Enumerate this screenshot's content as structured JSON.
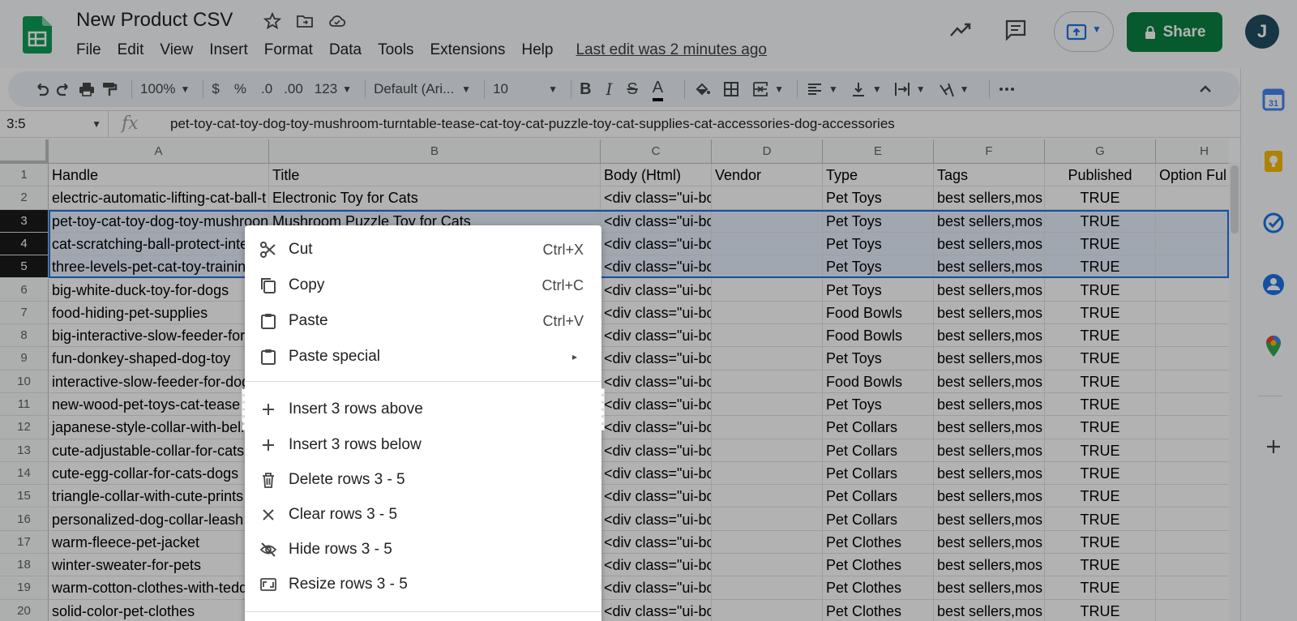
{
  "doc": {
    "title": "New Product CSV",
    "last_edit": "Last edit was 2 minutes ago"
  },
  "menus": [
    "File",
    "Edit",
    "View",
    "Insert",
    "Format",
    "Data",
    "Tools",
    "Extensions",
    "Help"
  ],
  "header": {
    "share_label": "Share",
    "avatar_initial": "J"
  },
  "toolbar": {
    "zoom": "100%",
    "currency": "$",
    "percent": "%",
    "dec_decrease": ".0",
    "dec_increase": ".00",
    "more_formats": "123",
    "font": "Default (Ari...",
    "font_size": "10",
    "bold": "B",
    "italic": "I",
    "strike": "S",
    "text_color": "A"
  },
  "formula": {
    "cell_ref": "3:5",
    "fx": "fx",
    "content": "pet-toy-cat-toy-dog-toy-mushroom-turntable-tease-cat-toy-cat-puzzle-toy-cat-supplies-cat-accessories-dog-accessories"
  },
  "grid": {
    "columns": [
      "A",
      "B",
      "C",
      "D",
      "E",
      "F",
      "G",
      "H"
    ],
    "rows": [
      {
        "n": "1",
        "cells": [
          "Handle",
          "Title",
          "Body (Html)",
          "Vendor",
          "Type",
          "Tags",
          "Published",
          "Option Ful"
        ]
      },
      {
        "n": "2",
        "cells": [
          "electric-automatic-lifting-cat-ball-t",
          "Electronic Toy for Cats",
          "<div class=\"ui-bo",
          "",
          "Pet Toys",
          "best sellers,mos",
          "TRUE",
          ""
        ]
      },
      {
        "n": "3",
        "cells": [
          "pet-toy-cat-toy-dog-toy-mushroon",
          "Mushroom Puzzle Toy for Cats",
          "<div class=\"ui-bo",
          "",
          "Pet Toys",
          "best sellers,mos",
          "TRUE",
          ""
        ]
      },
      {
        "n": "4",
        "cells": [
          "cat-scratching-ball-protect-inte",
          "",
          "<div class=\"ui-bo",
          "",
          "Pet Toys",
          "best sellers,mos",
          "TRUE",
          ""
        ]
      },
      {
        "n": "5",
        "cells": [
          "three-levels-pet-cat-toy-trainin",
          "",
          "<div class=\"ui-bo",
          "",
          "Pet Toys",
          "best sellers,mos",
          "TRUE",
          ""
        ]
      },
      {
        "n": "6",
        "cells": [
          "big-white-duck-toy-for-dogs",
          "",
          "<div class=\"ui-bo",
          "",
          "Pet Toys",
          "best sellers,mos",
          "TRUE",
          ""
        ]
      },
      {
        "n": "7",
        "cells": [
          "food-hiding-pet-supplies",
          "",
          "<div class=\"ui-bo",
          "",
          "Food Bowls",
          "best sellers,mos",
          "TRUE",
          ""
        ]
      },
      {
        "n": "8",
        "cells": [
          "big-interactive-slow-feeder-for",
          "",
          "<div class=\"ui-bo",
          "",
          "Food Bowls",
          "best sellers,mos",
          "TRUE",
          ""
        ]
      },
      {
        "n": "9",
        "cells": [
          "fun-donkey-shaped-dog-toy",
          "",
          "<div class=\"ui-bo",
          "",
          "Pet Toys",
          "best sellers,mos",
          "TRUE",
          ""
        ]
      },
      {
        "n": "10",
        "cells": [
          "interactive-slow-feeder-for-dog",
          "",
          "<div class=\"ui-bo",
          "",
          "Food Bowls",
          "best sellers,mos",
          "TRUE",
          ""
        ]
      },
      {
        "n": "11",
        "cells": [
          "new-wood-pet-toys-cat-tease",
          "",
          "<div class=\"ui-bo",
          "",
          "Pet Toys",
          "best sellers,mos",
          "TRUE",
          ""
        ]
      },
      {
        "n": "12",
        "cells": [
          "japanese-style-collar-with-bell",
          "",
          "<div class=\"ui-bo",
          "",
          "Pet Collars",
          "best sellers,mos",
          "TRUE",
          ""
        ]
      },
      {
        "n": "13",
        "cells": [
          "cute-adjustable-collar-for-cats",
          "",
          "<div class=\"ui-bo",
          "",
          "Pet Collars",
          "best sellers,mos",
          "TRUE",
          ""
        ]
      },
      {
        "n": "14",
        "cells": [
          "cute-egg-collar-for-cats-dogs",
          "",
          "<div class=\"ui-bo",
          "",
          "Pet Collars",
          "best sellers,mos",
          "TRUE",
          ""
        ]
      },
      {
        "n": "15",
        "cells": [
          "triangle-collar-with-cute-prints",
          "",
          "<div class=\"ui-bo",
          "",
          "Pet Collars",
          "best sellers,mos",
          "TRUE",
          ""
        ]
      },
      {
        "n": "16",
        "cells": [
          "personalized-dog-collar-leash",
          "",
          "<div class=\"ui-bo",
          "",
          "Pet Collars",
          "best sellers,mos",
          "TRUE",
          ""
        ]
      },
      {
        "n": "17",
        "cells": [
          "warm-fleece-pet-jacket",
          "",
          "<div class=\"ui-bo",
          "",
          "Pet Clothes",
          "best sellers,mos",
          "TRUE",
          ""
        ]
      },
      {
        "n": "18",
        "cells": [
          "winter-sweater-for-pets",
          "",
          "<div class=\"ui-bo",
          "",
          "Pet Clothes",
          "best sellers,mos",
          "TRUE",
          ""
        ]
      },
      {
        "n": "19",
        "cells": [
          "warm-cotton-clothes-with-tedd",
          "",
          "<div class=\"ui-bo",
          "",
          "Pet Clothes",
          "best sellers,mos",
          "TRUE",
          ""
        ]
      },
      {
        "n": "20",
        "cells": [
          "solid-color-pet-clothes",
          "",
          "<div class=\"ui-bo",
          "",
          "Pet Clothes",
          "best sellers,mos",
          "TRUE",
          ""
        ]
      }
    ]
  },
  "context_menu": {
    "cut": {
      "label": "Cut",
      "shortcut": "Ctrl+X"
    },
    "copy": {
      "label": "Copy",
      "shortcut": "Ctrl+C"
    },
    "paste": {
      "label": "Paste",
      "shortcut": "Ctrl+V"
    },
    "paste_special": {
      "label": "Paste special",
      "arrow": "▸"
    },
    "insert_above": {
      "label": "Insert 3 rows above"
    },
    "insert_below": {
      "label": "Insert 3 rows below"
    },
    "delete_rows": {
      "label": "Delete rows 3 - 5"
    },
    "clear_rows": {
      "label": "Clear rows 3 - 5"
    },
    "hide_rows": {
      "label": "Hide rows 3 - 5"
    },
    "resize_rows": {
      "label": "Resize rows 3 - 5"
    }
  },
  "colors": {
    "share_green": "#0b8043",
    "selection_blue": "#1a73e8",
    "selected_row_fill": "#e7f0fd"
  }
}
